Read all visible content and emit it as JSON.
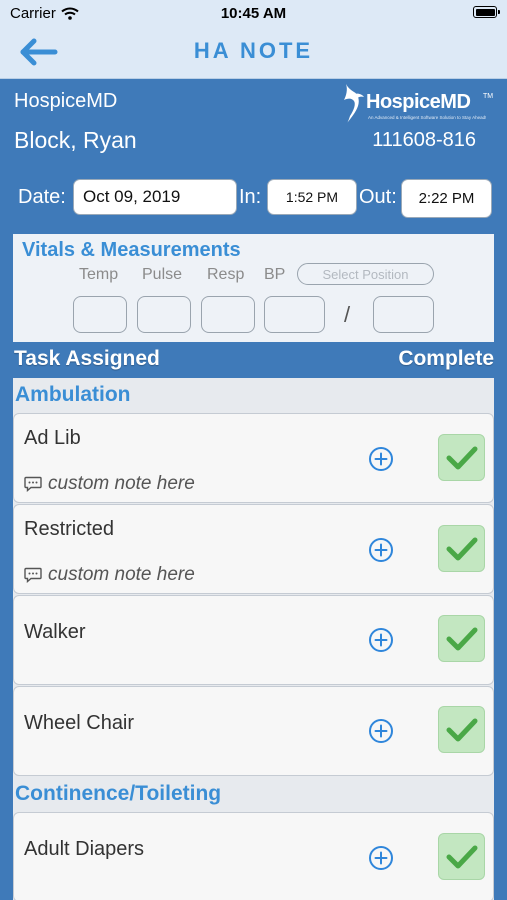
{
  "status_bar": {
    "carrier": "Carrier",
    "time": "10:45 AM"
  },
  "nav": {
    "title": "HA NOTE"
  },
  "header": {
    "org": "HospiceMD",
    "patient_name": "Block, Ryan",
    "patient_id": "111608-816",
    "logo": {
      "brand": "HospiceMD",
      "tm": "TM",
      "tagline": "An Advanced & Intelligent Software Solution to Stay Ahead!"
    }
  },
  "visit": {
    "date_label": "Date:",
    "date_value": "Oct 09, 2019",
    "in_label": "In:",
    "in_value": "1:52 PM",
    "out_label": "Out:",
    "out_value": "2:22 PM"
  },
  "vitals": {
    "title": "Vitals & Measurements",
    "columns": [
      "Temp",
      "Pulse",
      "Resp",
      "BP"
    ],
    "select_position_placeholder": "Select Position",
    "bp_separator": "/"
  },
  "tasks_header": {
    "left": "Task Assigned",
    "right": "Complete"
  },
  "sections": [
    {
      "title": "Ambulation",
      "tasks": [
        {
          "label": "Ad Lib",
          "note": "custom note here",
          "complete": true
        },
        {
          "label": "Restricted",
          "note": "custom note here",
          "complete": true
        },
        {
          "label": "Walker",
          "complete": true
        },
        {
          "label": "Wheel Chair",
          "complete": true
        }
      ]
    },
    {
      "title": "Continence/Toileting",
      "tasks": [
        {
          "label": "Adult Diapers",
          "complete": true
        }
      ]
    }
  ],
  "colors": {
    "background": "#3f7ab9",
    "accent": "#3a8ed5",
    "check_bg": "#c3e7c1",
    "check": "#4aa847"
  },
  "icons": [
    "wifi-icon",
    "battery-icon",
    "back-arrow-icon",
    "hospicemd-logo",
    "note-icon",
    "add-circle-icon",
    "checkmark-icon"
  ]
}
